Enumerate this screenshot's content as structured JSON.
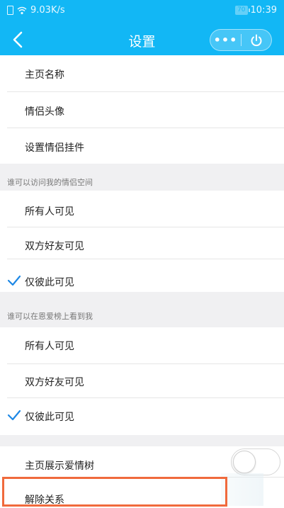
{
  "status_bar": {
    "speed": "9.03K/s",
    "battery": "70",
    "time": "10:39"
  },
  "nav": {
    "title": "设置",
    "more_label": "•••"
  },
  "main": {
    "items": [
      {
        "label": "主页名称"
      },
      {
        "label": "情侣头像"
      },
      {
        "label": "设置情侣挂件"
      }
    ]
  },
  "section_visit": {
    "header": "谁可以访问我的情侣空间",
    "options": [
      {
        "label": "所有人可见",
        "checked": false
      },
      {
        "label": "双方好友可见",
        "checked": false
      },
      {
        "label": "仅彼此可见",
        "checked": true
      }
    ]
  },
  "section_rank": {
    "header": "谁可以在恩爱榜上看到我",
    "options": [
      {
        "label": "所有人可见",
        "checked": false
      },
      {
        "label": "双方好友可见",
        "checked": false
      },
      {
        "label": "仅彼此可见",
        "checked": true
      }
    ]
  },
  "tree_row": {
    "label": "主页展示爱情树",
    "toggle_on": false
  },
  "unbind_row": {
    "label": "解除关系"
  },
  "colors": {
    "accent": "#12b7f5",
    "highlight": "#f06a3c",
    "check": "#1e88e5"
  }
}
